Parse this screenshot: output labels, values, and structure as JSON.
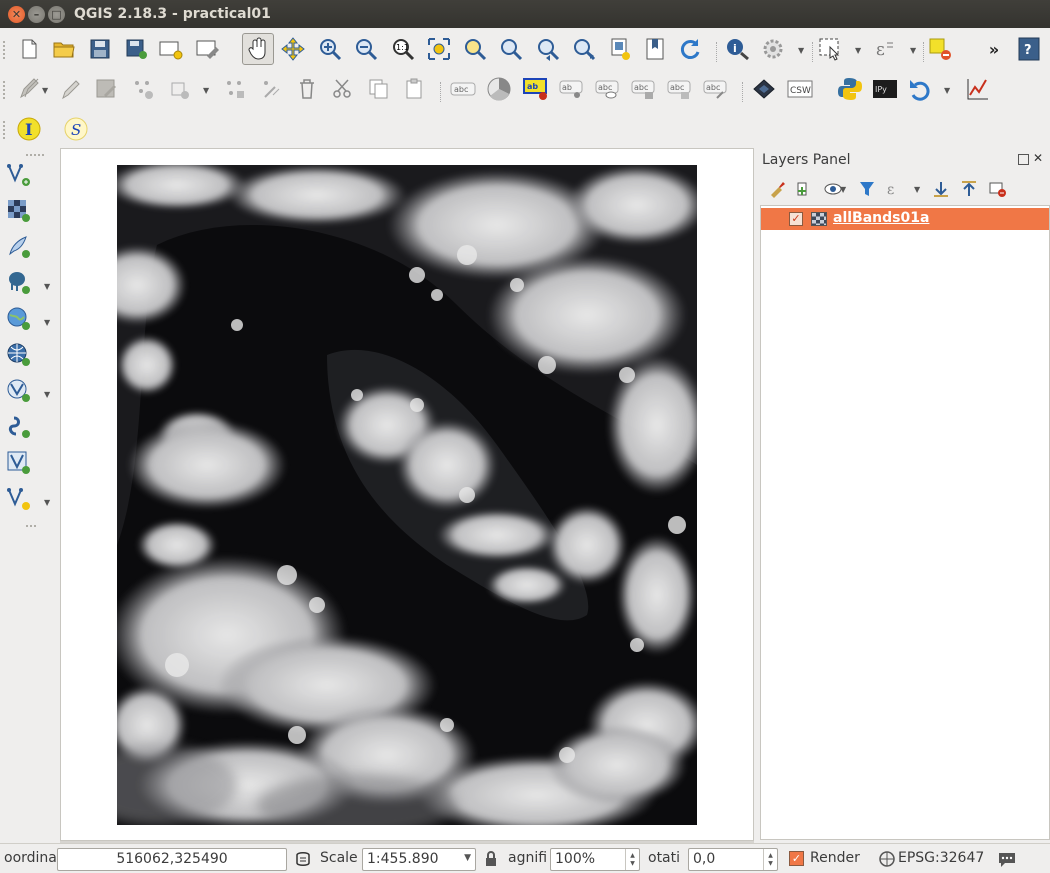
{
  "window": {
    "title": "QGIS 2.18.3 - practical01"
  },
  "toolbar": {
    "row1": [
      "new-project-icon",
      "open-project-icon",
      "save-project-icon",
      "save-as-icon",
      "new-print-composer-icon",
      "composer-manager-icon",
      "pan-icon",
      "pan-to-selection-icon",
      "zoom-in-icon",
      "zoom-out-icon",
      "zoom-native-icon",
      "zoom-full-icon",
      "zoom-to-selection-icon",
      "zoom-to-layer-icon",
      "zoom-last-icon",
      "zoom-next-icon",
      "new-map-view-icon",
      "new-bookmark-icon",
      "refresh-icon",
      "identify-icon",
      "run-action-icon",
      "select-features-icon",
      "field-calculator-icon",
      "deselect-icon",
      "more-icon",
      "help-icon"
    ],
    "row2": [
      "current-edits-icon",
      "toggle-editing-icon",
      "save-layer-edits-icon",
      "add-feature-icon",
      "move-feature-icon",
      "node-tool-icon",
      "delete-selected-icon",
      "cut-features-icon",
      "copy-features-icon",
      "paste-features-icon",
      "label-icon",
      "diagram-icon",
      "layer-labeling-icon",
      "pin-labels-icon",
      "show-hide-labels-icon",
      "move-label-icon",
      "rotate-label-icon",
      "change-label-icon",
      "raster-icon",
      "csw-label",
      "python-icon",
      "ipython-icon",
      "undo-icon",
      "profile-tool-icon"
    ],
    "row3": [
      "info-plugin-icon",
      "script-icon"
    ],
    "csw_label": "CSW",
    "ipython_label": "IPy"
  },
  "left_toolbar": [
    "add-vector-layer-icon",
    "add-raster-layer-icon",
    "add-delimited-text-icon",
    "add-postgis-icon",
    "add-wms-icon",
    "add-wcs-icon",
    "add-wfs-icon",
    "add-spatialite-icon",
    "add-virtual-layer-icon",
    "new-shapefile-icon"
  ],
  "layers_panel": {
    "title": "Layers Panel",
    "layers": [
      {
        "name": "allBands01a",
        "checked": true,
        "selected": true
      }
    ]
  },
  "statusbar": {
    "coordinate_label": "oordina",
    "coordinate_value": "516062,325490",
    "scale_label": "Scale",
    "scale_value": "1:455.890",
    "magnifier_label": "agnifi",
    "magnifier_value": "100%",
    "rotation_label": "otati",
    "rotation_value": "0,0",
    "render_label": "Render",
    "render_checked": true,
    "crs_label": "EPSG:32647"
  },
  "colors": {
    "accent": "#f07746",
    "titlebar": "#3a3935",
    "close": "#e05a2b"
  }
}
